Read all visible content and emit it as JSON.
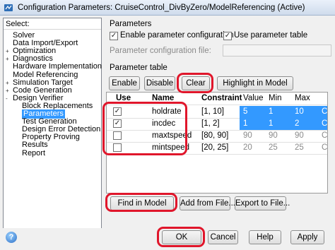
{
  "window": {
    "title": "Configuration Parameters: CruiseControl_DivByZero/ModelReferencing (Active)"
  },
  "left": {
    "header": "Select:",
    "items": [
      {
        "label": "Solver",
        "level": 0,
        "toggle": ""
      },
      {
        "label": "Data Import/Export",
        "level": 0,
        "toggle": ""
      },
      {
        "label": "Optimization",
        "level": 0,
        "toggle": "+"
      },
      {
        "label": "Diagnostics",
        "level": 0,
        "toggle": "+"
      },
      {
        "label": "Hardware Implementation",
        "level": 0,
        "toggle": ""
      },
      {
        "label": "Model Referencing",
        "level": 0,
        "toggle": ""
      },
      {
        "label": "Simulation Target",
        "level": 0,
        "toggle": "+"
      },
      {
        "label": "Code Generation",
        "level": 0,
        "toggle": "+"
      },
      {
        "label": "Design Verifier",
        "level": 0,
        "toggle": "-"
      },
      {
        "label": "Block Replacements",
        "level": 1,
        "toggle": ""
      },
      {
        "label": "Parameters",
        "level": 1,
        "toggle": "",
        "selected": true
      },
      {
        "label": "Test Generation",
        "level": 1,
        "toggle": ""
      },
      {
        "label": "Design Error Detection",
        "level": 1,
        "toggle": ""
      },
      {
        "label": "Property Proving",
        "level": 1,
        "toggle": ""
      },
      {
        "label": "Results",
        "level": 1,
        "toggle": ""
      },
      {
        "label": "Report",
        "level": 1,
        "toggle": ""
      }
    ]
  },
  "parameters": {
    "section_title": "Parameters",
    "enable_config_label": "Enable parameter configuration",
    "enable_config_checked": "✓",
    "use_table_label": "Use parameter table",
    "use_table_checked": "✓",
    "config_file_label": "Parameter configuration file:",
    "table_title": "Parameter table"
  },
  "toolbar": {
    "enable": "Enable",
    "disable": "Disable",
    "clear": "Clear",
    "highlight": "Highlight in Model"
  },
  "table": {
    "headers": {
      "use": "Use",
      "name": "Name",
      "constraint": "Constraint",
      "value": "Value",
      "min": "Min",
      "max": "Max"
    },
    "rows": [
      {
        "use": "✓",
        "name": "holdrate",
        "constraint": "[1, 10]",
        "value": "5",
        "min": "1",
        "max": "10",
        "extra": "C",
        "selected": true
      },
      {
        "use": "✓",
        "name": "incdec",
        "constraint": "[1, 2]",
        "value": "1",
        "min": "1",
        "max": "2",
        "extra": "C",
        "selected": true
      },
      {
        "use": "",
        "name": "maxtspeed",
        "constraint": "[80, 90]",
        "value": "90",
        "min": "90",
        "max": "90",
        "extra": "C",
        "selected": false
      },
      {
        "use": "",
        "name": "mintspeed",
        "constraint": "[20, 25]",
        "value": "20",
        "min": "25",
        "max": "25",
        "extra": "C",
        "selected": false
      }
    ]
  },
  "actions": {
    "find": "Find in Model",
    "add_file": "Add from File...",
    "export_file": "Export to File..."
  },
  "dialog": {
    "ok": "OK",
    "cancel": "Cancel",
    "help": "Help",
    "apply": "Apply",
    "help_icon": "?"
  },
  "colors": {
    "selection": "#3399ff",
    "highlight_box": "#e0162b"
  }
}
